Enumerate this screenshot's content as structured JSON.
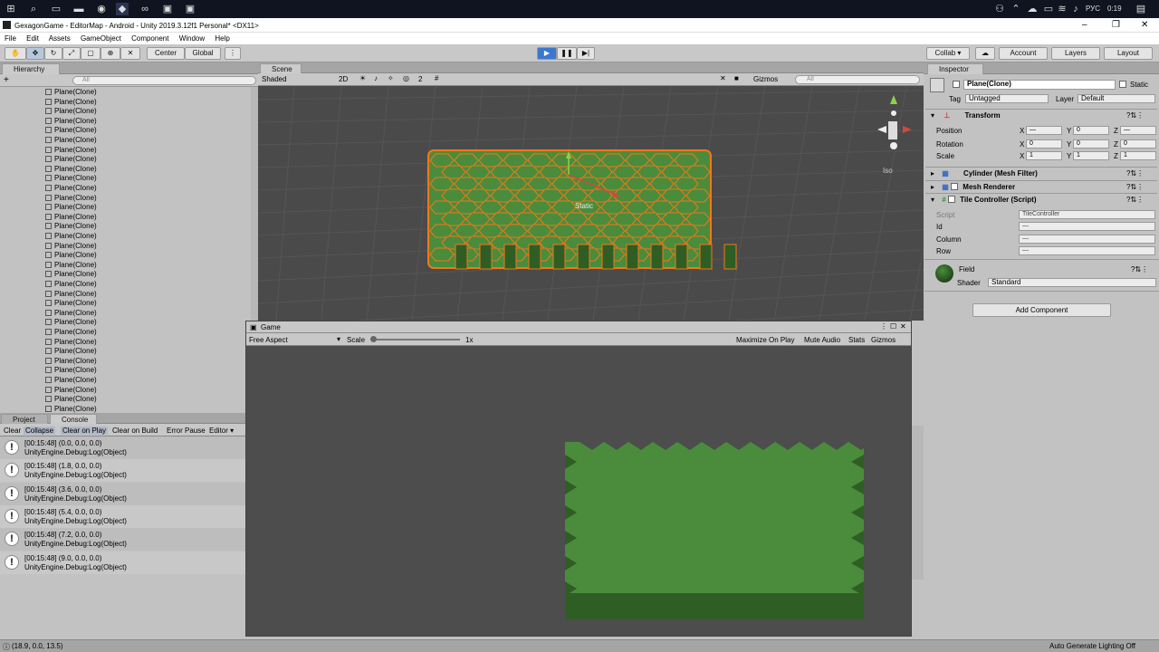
{
  "taskbar": {
    "lang": "РУС",
    "time": "0:19"
  },
  "window": {
    "title": "GexagonGame - EditorMap - Android - Unity 2019.3.12f1 Personal* <DX11>",
    "min": "–",
    "max": "❐",
    "close": "✕"
  },
  "menu": [
    "File",
    "Edit",
    "Assets",
    "GameObject",
    "Component",
    "Window",
    "Help"
  ],
  "toolbar": {
    "center": "Center",
    "global": "Global",
    "collab": "Collab ▾",
    "account": "Account",
    "layers": "Layers",
    "layout": "Layout"
  },
  "hierarchy": {
    "tab": "Hierarchy",
    "search_placeholder": "All",
    "add": "+",
    "items": [
      "Plane(Clone)",
      "Plane(Clone)",
      "Plane(Clone)",
      "Plane(Clone)",
      "Plane(Clone)",
      "Plane(Clone)",
      "Plane(Clone)",
      "Plane(Clone)",
      "Plane(Clone)",
      "Plane(Clone)",
      "Plane(Clone)",
      "Plane(Clone)",
      "Plane(Clone)",
      "Plane(Clone)",
      "Plane(Clone)",
      "Plane(Clone)",
      "Plane(Clone)",
      "Plane(Clone)",
      "Plane(Clone)",
      "Plane(Clone)",
      "Plane(Clone)",
      "Plane(Clone)",
      "Plane(Clone)",
      "Plane(Clone)",
      "Plane(Clone)",
      "Plane(Clone)",
      "Plane(Clone)",
      "Plane(Clone)",
      "Plane(Clone)",
      "Plane(Clone)",
      "Plane(Clone)",
      "Plane(Clone)",
      "Plane(Clone)",
      "Plane(Clone)"
    ]
  },
  "scene": {
    "tab": "Scene",
    "shading": "Shaded",
    "mode2d": "2D",
    "fx_count": "2",
    "gizmos": "Gizmos",
    "search_placeholder": "All",
    "iso": "Iso",
    "static_label": "Static"
  },
  "game": {
    "tab": "Game",
    "aspect": "Free Aspect",
    "scale_label": "Scale",
    "scale_value": "1x",
    "maximize": "Maximize On Play",
    "mute": "Mute Audio",
    "stats": "Stats",
    "gizmos": "Gizmos"
  },
  "console": {
    "tab_project": "Project",
    "tab_console": "Console",
    "buttons": [
      "Clear",
      "Collapse",
      "Clear on Play",
      "Clear on Build",
      "Error Pause",
      "Editor ▾"
    ],
    "entries": [
      {
        "l1": "[00:15:48] (0.0, 0.0, 0.0)",
        "l2": "UnityEngine.Debug:Log(Object)"
      },
      {
        "l1": "[00:15:48] (1.8, 0.0, 0.0)",
        "l2": "UnityEngine.Debug:Log(Object)"
      },
      {
        "l1": "[00:15:48] (3.6, 0.0, 0.0)",
        "l2": "UnityEngine.Debug:Log(Object)"
      },
      {
        "l1": "[00:15:48] (5.4, 0.0, 0.0)",
        "l2": "UnityEngine.Debug:Log(Object)"
      },
      {
        "l1": "[00:15:48] (7.2, 0.0, 0.0)",
        "l2": "UnityEngine.Debug:Log(Object)"
      },
      {
        "l1": "[00:15:48] (9.0, 0.0, 0.0)",
        "l2": "UnityEngine.Debug:Log(Object)"
      }
    ]
  },
  "inspector": {
    "tab": "Inspector",
    "object_name": "Plane(Clone)",
    "static": "Static",
    "tag_label": "Tag",
    "tag_value": "Untagged",
    "layer_label": "Layer",
    "layer_value": "Default",
    "transform": "Transform",
    "position": "Position",
    "rotation": "Rotation",
    "scale": "Scale",
    "pos": [
      "—",
      "0",
      "—"
    ],
    "rot": [
      "0",
      "0",
      "0"
    ],
    "scl": [
      "1",
      "1",
      "1"
    ],
    "x": "X",
    "y": "Y",
    "z": "Z",
    "mesh_filter": "Cylinder (Mesh Filter)",
    "mesh_renderer": "Mesh Renderer",
    "tile_controller": "Tile Controller (Script)",
    "script_label": "Script",
    "script_value": "TileController",
    "id_label": "Id",
    "column_label": "Column",
    "row_label": "Row",
    "dash": "—",
    "material": "Field",
    "shader_label": "Shader",
    "shader_value": "Standard",
    "add_component": "Add Component"
  },
  "status": {
    "log": "(18.9, 0.0, 13.5)",
    "lighting": "Auto Generate Lighting Off"
  },
  "colors": {
    "hex_green": "#4a8c3c",
    "hex_dark": "#2f5e25",
    "hex_outline": "#f07818",
    "play_blue": "#3a78d0"
  }
}
